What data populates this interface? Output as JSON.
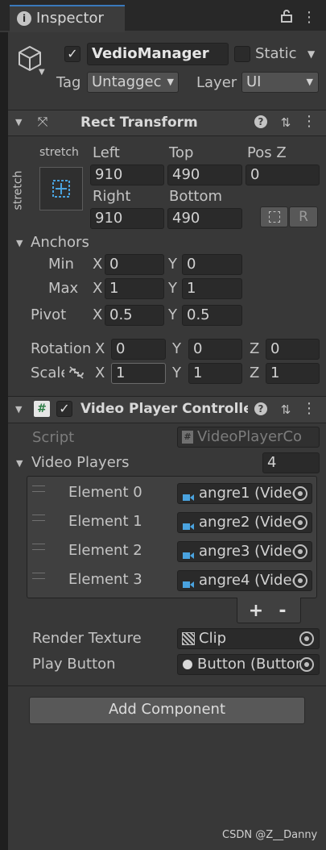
{
  "tab": {
    "title": "Inspector"
  },
  "gameobject": {
    "name": "VedioManager",
    "static_label": "Static",
    "tag_label": "Tag",
    "tag_value": "Untaggec",
    "layer_label": "Layer",
    "layer_value": "UI"
  },
  "rect_transform": {
    "title": "Rect Transform",
    "stretch_h": "stretch",
    "stretch_v": "stretch",
    "left_label": "Left",
    "left_value": "910",
    "top_label": "Top",
    "top_value": "490",
    "posz_label": "Pos Z",
    "posz_value": "0",
    "right_label": "Right",
    "right_value": "910",
    "bottom_label": "Bottom",
    "bottom_value": "490",
    "r_label": "R",
    "anchors_label": "Anchors",
    "min_label": "Min",
    "min_x": "0",
    "min_y": "0",
    "max_label": "Max",
    "max_x": "1",
    "max_y": "1",
    "pivot_label": "Pivot",
    "pivot_x": "0.5",
    "pivot_y": "0.5",
    "rotation_label": "Rotation",
    "rot_x": "0",
    "rot_y": "0",
    "rot_z": "0",
    "scale_label": "Scale",
    "scale_x": "1",
    "scale_y": "1",
    "scale_z": "1",
    "x": "X",
    "y": "Y",
    "z": "Z"
  },
  "video_controller": {
    "title": "Video Player Controlle",
    "script_label": "Script",
    "script_value": "VideoPlayerCo",
    "players_label": "Video Players",
    "players_count": "4",
    "elements": [
      {
        "label": "Element 0",
        "value": "angre1 (Videc"
      },
      {
        "label": "Element 1",
        "value": "angre2 (Videc"
      },
      {
        "label": "Element 2",
        "value": "angre3 (Videc"
      },
      {
        "label": "Element 3",
        "value": "angre4 (Videc"
      }
    ],
    "plus": "+",
    "minus": "-",
    "render_texture_label": "Render Texture",
    "render_texture_value": "Clip",
    "play_button_label": "Play Button",
    "play_button_value": "Button (Button"
  },
  "add_component_label": "Add Component",
  "watermark": "CSDN @Z__Danny",
  "colors": {
    "accent": "#3a79bb",
    "panel": "#383838",
    "field": "#2a2a2a",
    "video_icon": "#4aa3df"
  }
}
